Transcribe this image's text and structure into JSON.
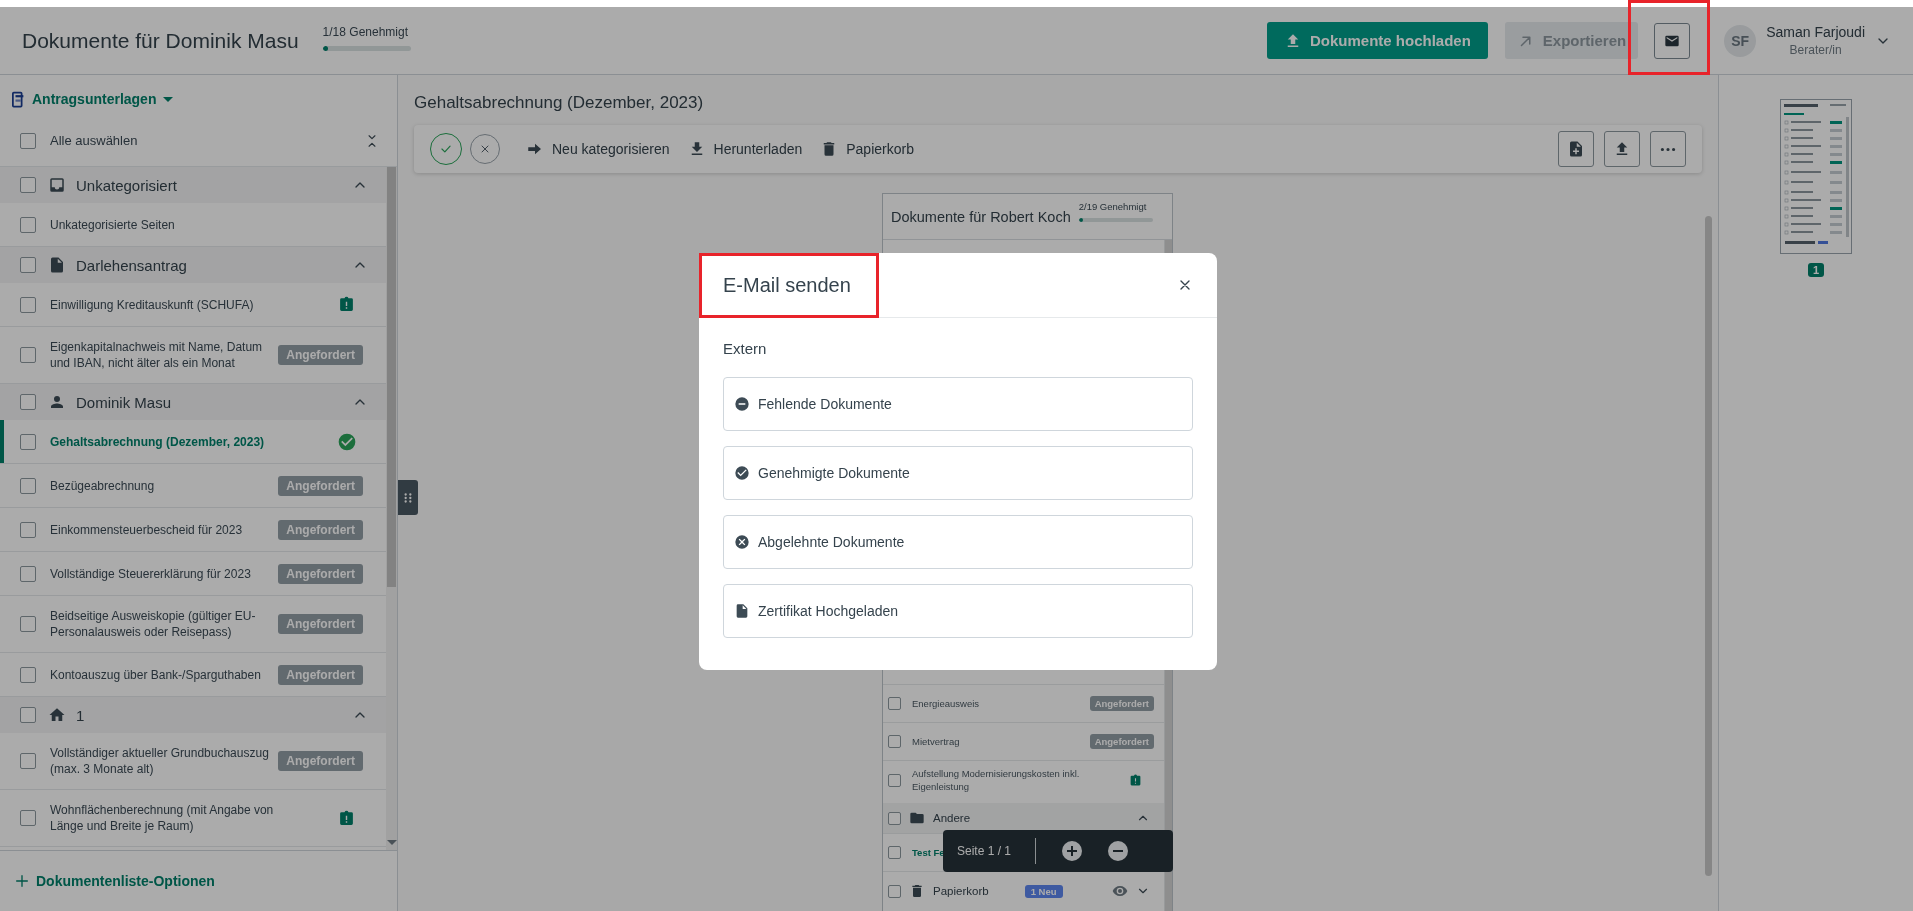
{
  "header": {
    "title": "Dokumente für Dominik Masu",
    "progress": {
      "label": "1/18 Genehmigt",
      "level": 0.06
    },
    "upload_button": "Dokumente hochladen",
    "export_button": {
      "label": "Exportieren",
      "disabled": true
    },
    "mail_button": {
      "highlighted": true
    },
    "user": {
      "initials": "SF",
      "name": "Saman Farjoudi",
      "role": "Berater/in"
    }
  },
  "sidebar": {
    "category_menu": "Antragsunterlagen",
    "select_all": {
      "label": "Alle auswählen",
      "checked": false
    },
    "groups": [
      {
        "title": "Unkategorisiert",
        "checked": false,
        "expanded": true,
        "items": [
          {
            "label": "Unkategorisierte Seiten",
            "checked": false,
            "selected": false,
            "marker": {
              "kind": "none"
            }
          }
        ]
      },
      {
        "title": "Darlehensantrag",
        "checked": false,
        "expanded": true,
        "items": [
          {
            "label": "Einwilligung Kreditauskunft (SCHUFA)",
            "checked": false,
            "selected": false,
            "marker": {
              "kind": "alert"
            }
          },
          {
            "label": "Eigenkapitalnachweis mit Name, Datum und IBAN, nicht älter als ein Monat",
            "checked": false,
            "selected": false,
            "marker": {
              "kind": "badge",
              "text": "Angefordert"
            }
          }
        ]
      },
      {
        "title": "Dominik Masu",
        "checked": false,
        "expanded": true,
        "items": [
          {
            "label": "Gehaltsabrechnung (Dezember, 2023)",
            "checked": false,
            "selected": true,
            "marker": {
              "kind": "approved"
            }
          },
          {
            "label": "Bezügeabrechnung",
            "checked": false,
            "selected": false,
            "marker": {
              "kind": "badge",
              "text": "Angefordert"
            }
          },
          {
            "label": "Einkommensteuerbescheid für 2023",
            "checked": false,
            "selected": false,
            "marker": {
              "kind": "badge",
              "text": "Angefordert"
            }
          },
          {
            "label": "Vollständige Steuererklärung für 2023",
            "checked": false,
            "selected": false,
            "marker": {
              "kind": "badge",
              "text": "Angefordert"
            }
          },
          {
            "label": "Beidseitige Ausweiskopie (gültiger EU-Personalausweis oder Reisepass)",
            "checked": false,
            "selected": false,
            "marker": {
              "kind": "badge",
              "text": "Angefordert"
            }
          },
          {
            "label": "Kontoauszug über Bank-/Sparguthaben",
            "checked": false,
            "selected": false,
            "marker": {
              "kind": "badge",
              "text": "Angefordert"
            }
          }
        ]
      },
      {
        "title": "1",
        "checked": false,
        "expanded": true,
        "items": [
          {
            "label": "Vollständiger aktueller Grundbuchauszug (max. 3 Monate alt)",
            "checked": false,
            "selected": false,
            "marker": {
              "kind": "badge",
              "text": "Angefordert"
            }
          },
          {
            "label": "Wohnflächenberechnung (mit Angabe von Länge und Breite je Raum)",
            "checked": false,
            "selected": false,
            "marker": {
              "kind": "alert"
            }
          }
        ]
      }
    ],
    "footer": "Dokumentenliste-Optionen"
  },
  "document": {
    "title": "Gehaltsabrechnung (Dezember, 2023)",
    "actions": [
      "Neu kategorisieren",
      "Herunterladen",
      "Papierkorb"
    ],
    "preview": {
      "title": "Dokumente für Robert Koch",
      "progress": {
        "label": "2/19 Genehmigt",
        "level": 0.06
      },
      "rows": [
        {
          "kind": "item",
          "label": "Energieausweis",
          "checked": false,
          "selected": false,
          "marker": {
            "kind": "badge",
            "text": "Angefordert"
          }
        },
        {
          "kind": "item",
          "label": "Mietvertrag",
          "checked": false,
          "selected": false,
          "marker": {
            "kind": "badge",
            "text": "Angefordert"
          }
        },
        {
          "kind": "item",
          "label": "Aufstellung Modernisierungskosten inkl. Eigenleistung",
          "checked": false,
          "selected": false,
          "marker": {
            "kind": "alert"
          }
        },
        {
          "kind": "group",
          "label": "Andere",
          "checked": false,
          "expanded": true
        },
        {
          "kind": "item",
          "label": "Test Fe",
          "checked": false,
          "selected": true,
          "marker": {
            "kind": "none"
          }
        },
        {
          "kind": "trash",
          "label": "Papierkorb",
          "checked": false,
          "badge": "1 Neu",
          "expanded": false
        }
      ]
    },
    "pager": {
      "label": "Seite 1 / 1"
    }
  },
  "thumbnails": [
    {
      "page": "1",
      "selected": true
    }
  ],
  "modal": {
    "title": "E-Mail senden",
    "highlighted": true,
    "section": "Extern",
    "options": [
      "Fehlende Dokumente",
      "Genehmigte Dokumente",
      "Abgelehnte Dokumente",
      "Zertifikat Hochgeladen"
    ]
  }
}
